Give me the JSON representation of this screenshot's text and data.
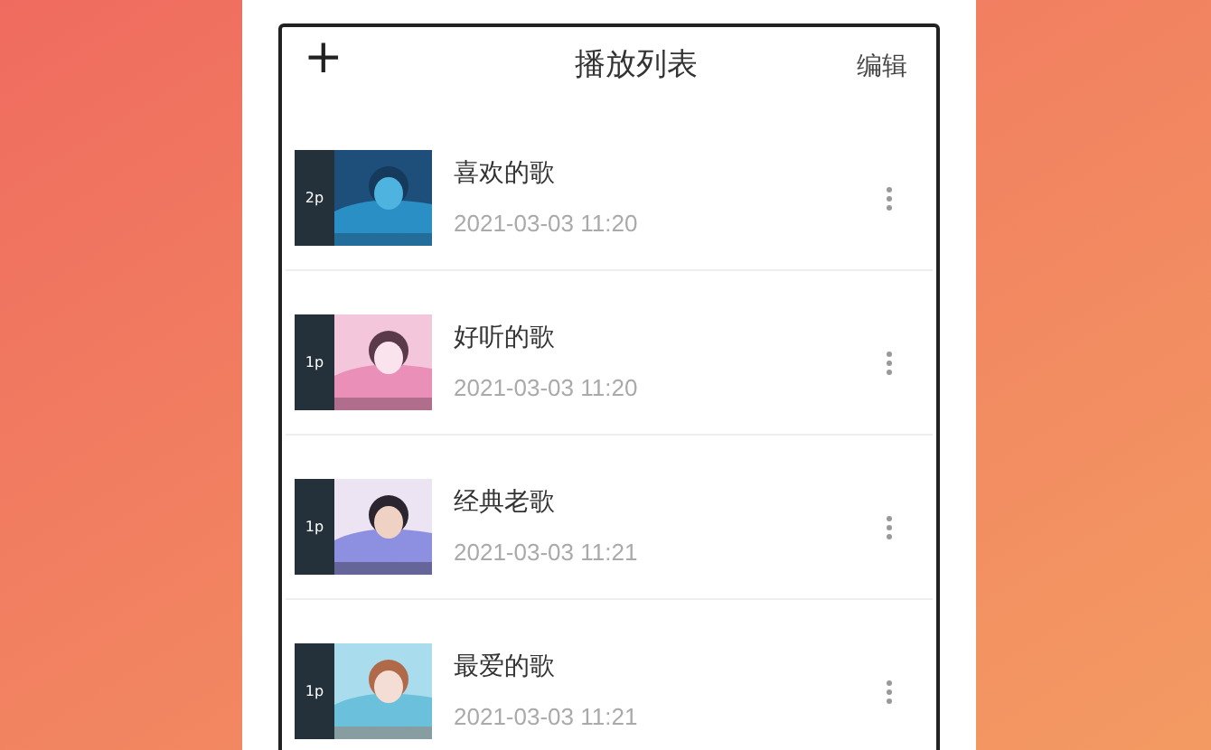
{
  "header": {
    "add_icon_text": "+",
    "title": "播放列表",
    "edit": "编辑"
  },
  "playlists": [
    {
      "count": "2p",
      "title": "喜欢的歌",
      "date": "2021-03-03 11:20"
    },
    {
      "count": "1p",
      "title": "好听的歌",
      "date": "2021-03-03 11:20"
    },
    {
      "count": "1p",
      "title": "经典老歌",
      "date": "2021-03-03 11:21"
    },
    {
      "count": "1p",
      "title": "最爱的歌",
      "date": "2021-03-03 11:21"
    }
  ]
}
